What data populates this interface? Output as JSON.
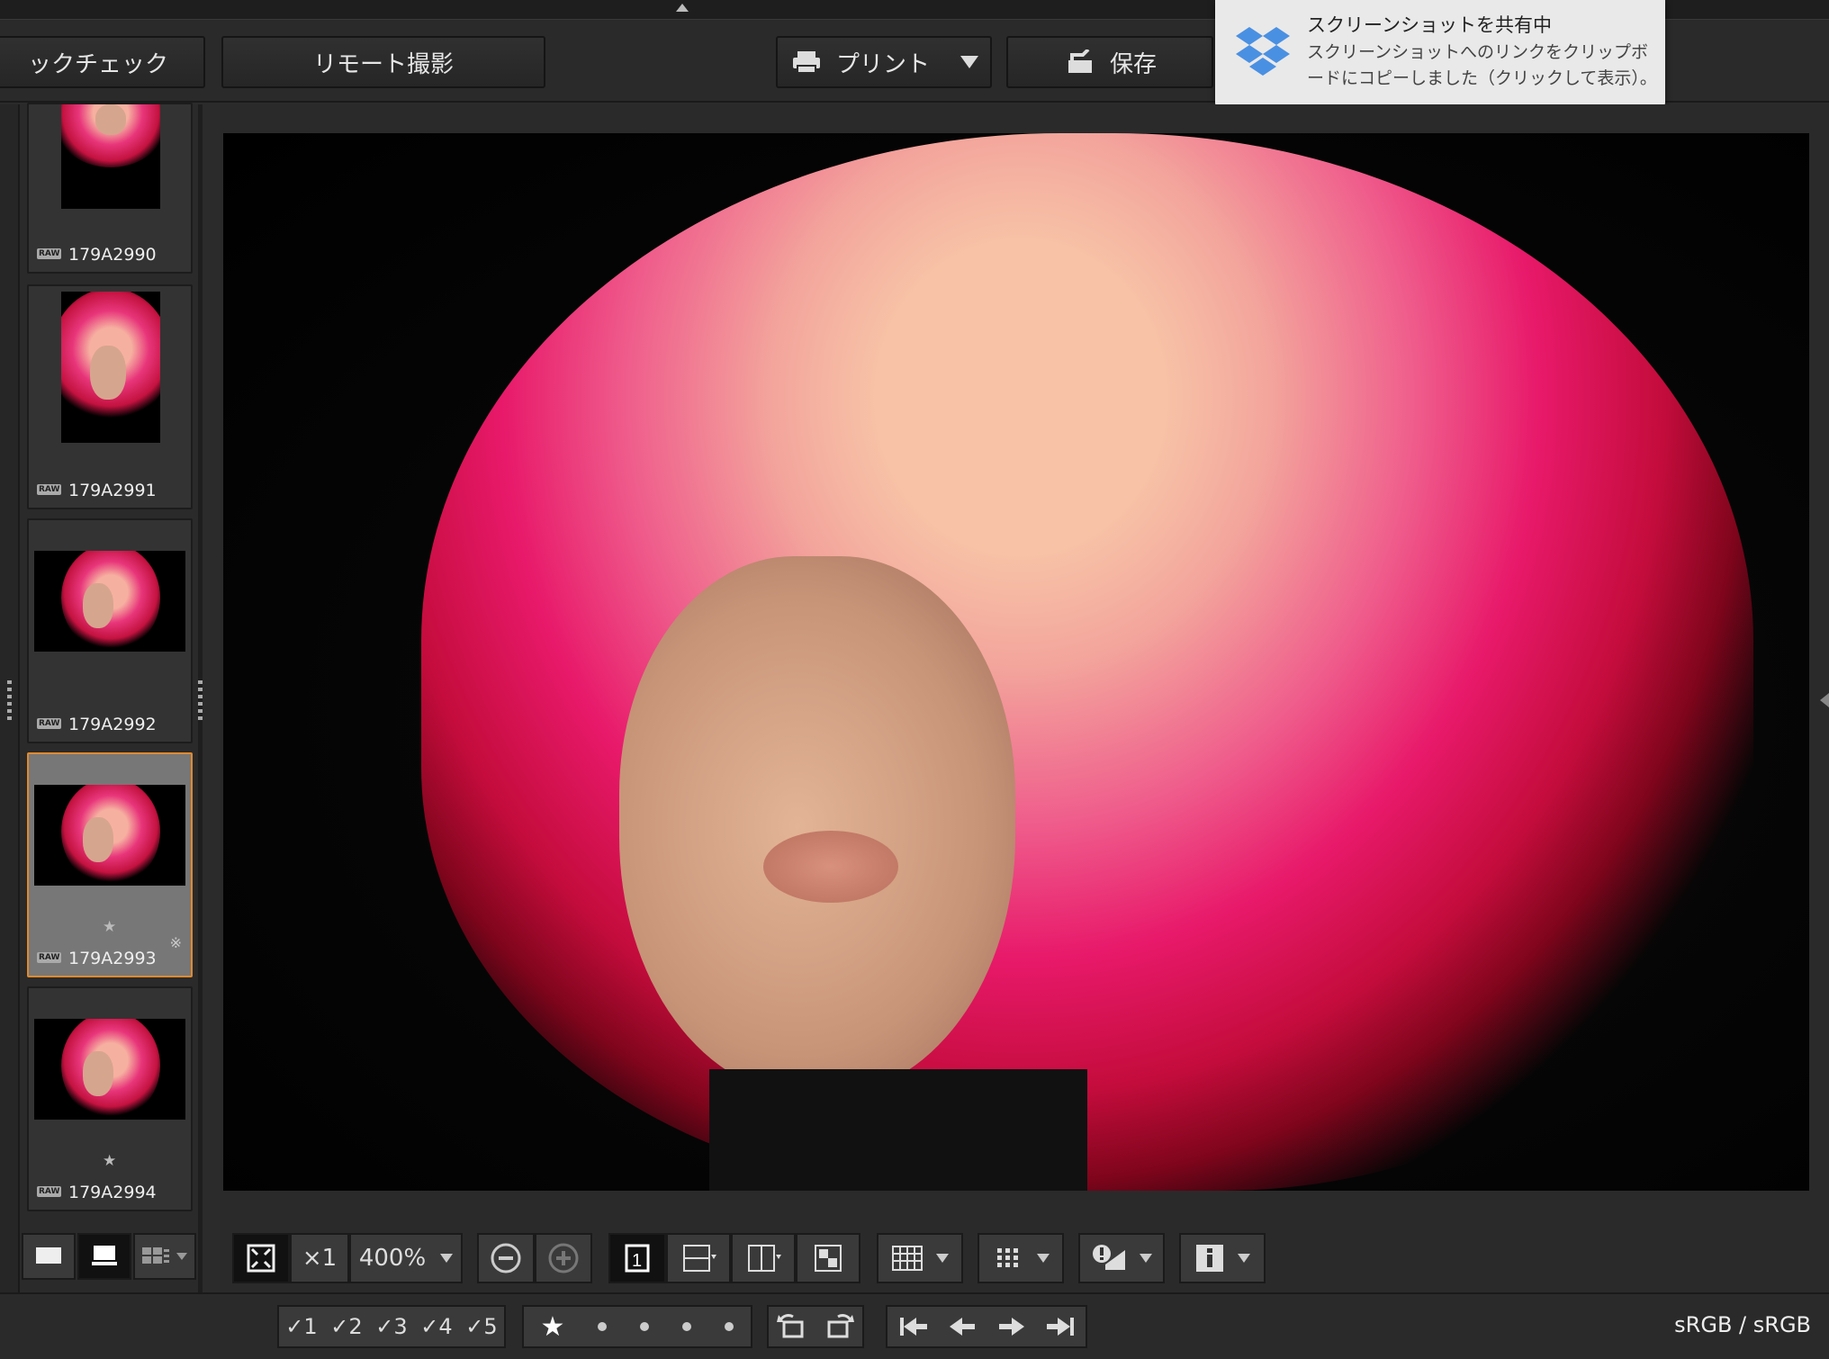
{
  "toolbar": {
    "quick_check": "ックチェック",
    "remote_shoot": "リモート撮影",
    "print": "プリント",
    "save": "保存"
  },
  "toast": {
    "title": "スクリーンショットを共有中",
    "message": "スクリーンショットへのリンクをクリップボードにコピーしました（クリックして表示）。"
  },
  "thumbnails": [
    {
      "name": "179A2990",
      "badge": "RAW",
      "rating": ""
    },
    {
      "name": "179A2991",
      "badge": "RAW",
      "rating": ""
    },
    {
      "name": "179A2992",
      "badge": "RAW",
      "rating": ""
    },
    {
      "name": "179A2993",
      "badge": "RAW",
      "rating": "★",
      "selected": true
    },
    {
      "name": "179A2994",
      "badge": "RAW",
      "rating": "★"
    }
  ],
  "viewer": {
    "zoom_1x": "×1",
    "zoom_level": "400%"
  },
  "rating_bar": {
    "ratings": [
      "1",
      "2",
      "3",
      "4",
      "5"
    ]
  },
  "status": {
    "color_space": "sRGB / sRGB"
  },
  "colors": {
    "accent": "#e08a2e",
    "bg": "#2a2a2a"
  }
}
